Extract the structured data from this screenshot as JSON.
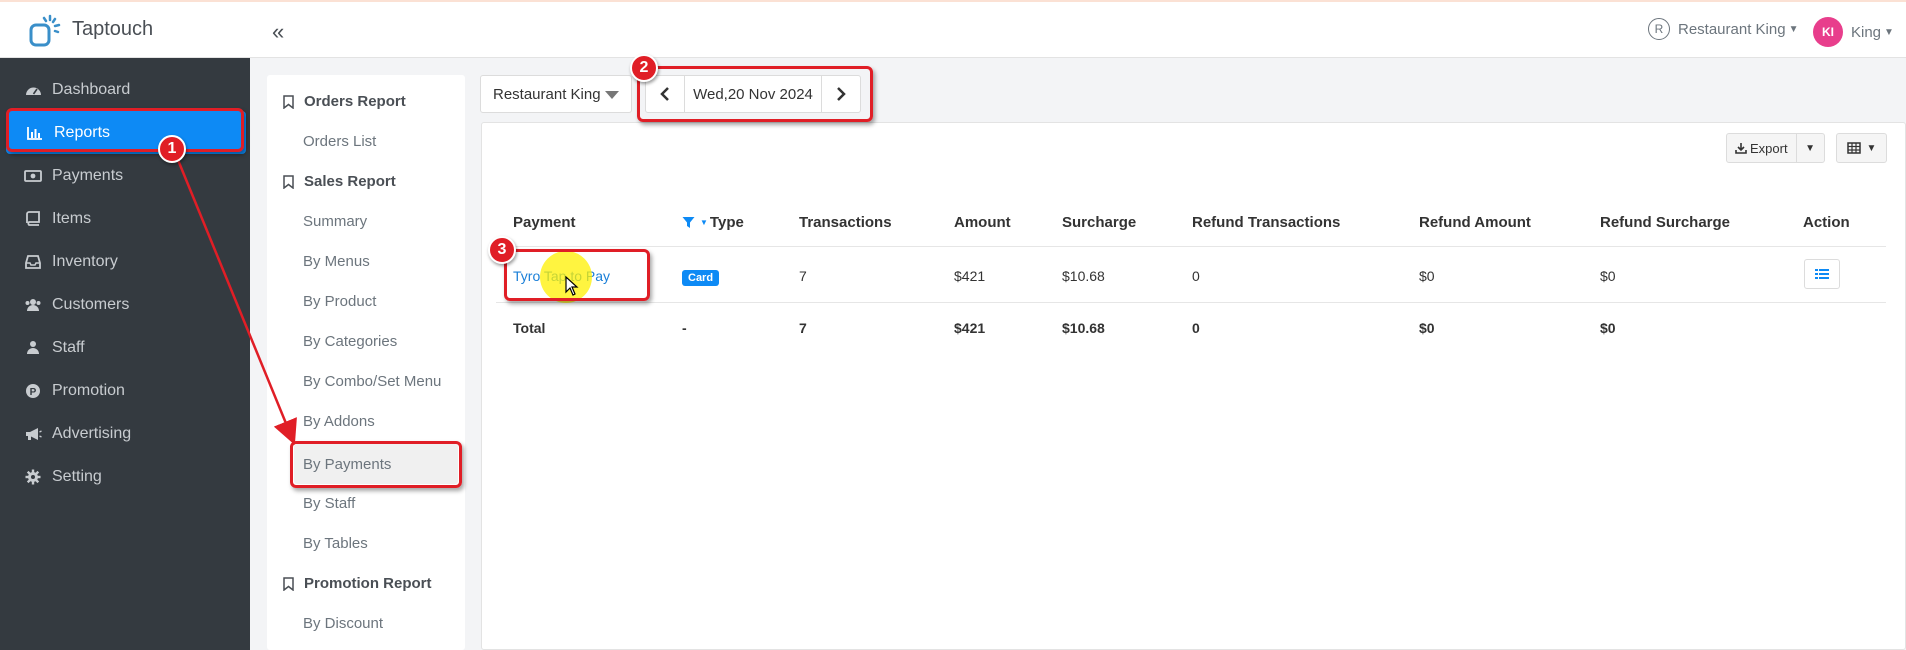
{
  "brand": {
    "name": "Taptouch"
  },
  "sidebar": {
    "items": [
      {
        "label": "Dashboard",
        "icon": "dashboard-icon",
        "active": false
      },
      {
        "label": "Reports",
        "icon": "bar-chart-icon",
        "active": true
      },
      {
        "label": "Payments",
        "icon": "money-icon",
        "active": false
      },
      {
        "label": "Items",
        "icon": "book-icon",
        "active": false
      },
      {
        "label": "Inventory",
        "icon": "inbox-icon",
        "active": false
      },
      {
        "label": "Customers",
        "icon": "users-icon",
        "active": false
      },
      {
        "label": "Staff",
        "icon": "staff-icon",
        "active": false
      },
      {
        "label": "Promotion",
        "icon": "promotion-icon",
        "active": false
      },
      {
        "label": "Advertising",
        "icon": "megaphone-icon",
        "active": false
      },
      {
        "label": "Setting",
        "icon": "gear-icon",
        "active": false
      }
    ]
  },
  "header": {
    "collapse_glyph": "«",
    "restaurant_badge": "R",
    "restaurant_label": "Restaurant King",
    "user_initials": "KI",
    "user_name": "King"
  },
  "report_menu": {
    "sections": [
      {
        "title": "Orders Report",
        "items": [
          "Orders List"
        ]
      },
      {
        "title": "Sales Report",
        "items": [
          "Summary",
          "By Menus",
          "By Product",
          "By Categories",
          "By Combo/Set Menu",
          "By Addons",
          "By Payments",
          "By Staff",
          "By Tables"
        ]
      },
      {
        "title": "Promotion Report",
        "items": [
          "By Discount"
        ]
      }
    ],
    "active_item": "By Payments"
  },
  "filters": {
    "restaurant": "Restaurant King",
    "date": "Wed,20 Nov 2024"
  },
  "toolbar": {
    "export_label": "Export"
  },
  "table": {
    "columns": [
      "Payment",
      "Type",
      "Transactions",
      "Amount",
      "Surcharge",
      "Refund Transactions",
      "Refund Amount",
      "Refund Surcharge",
      "Action"
    ],
    "rows": [
      {
        "payment": "Tyro Tap to Pay",
        "type": "Card",
        "transactions": "7",
        "amount": "$421",
        "surcharge": "$10.68",
        "refund_transactions": "0",
        "refund_amount": "$0",
        "refund_surcharge": "$0"
      }
    ],
    "total": {
      "label": "Total",
      "type": "-",
      "transactions": "7",
      "amount": "$421",
      "surcharge": "$10.68",
      "refund_transactions": "0",
      "refund_amount": "$0",
      "refund_surcharge": "$0"
    }
  },
  "annotations": {
    "step1": "1",
    "step2": "2",
    "step3": "3"
  },
  "colors": {
    "accent": "#0d8af5",
    "sidebar": "#343a40",
    "annotation": "#e01e26",
    "avatar": "#e83e8c"
  }
}
